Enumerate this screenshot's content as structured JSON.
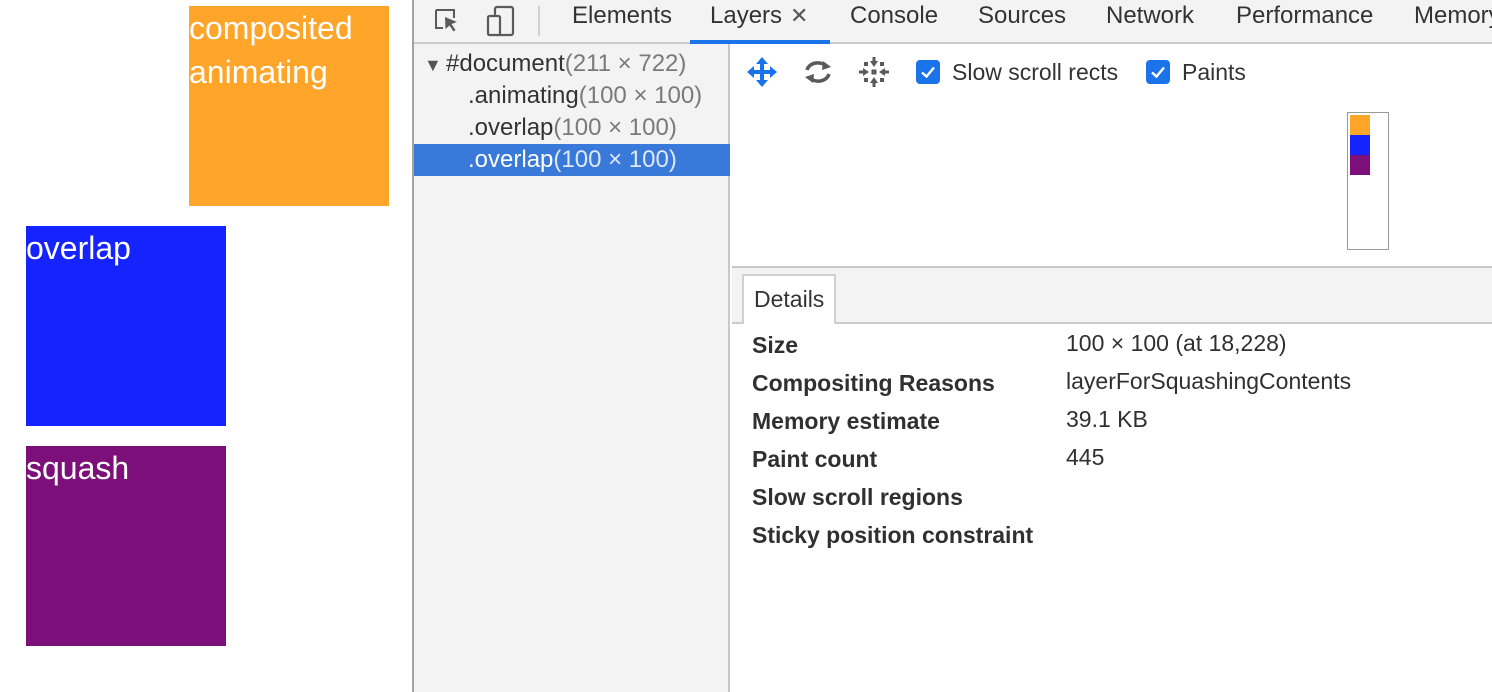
{
  "viewport": {
    "boxes": [
      {
        "id": "animating",
        "text_line1": "composited",
        "text_line2": "animating",
        "color": "#fea52a"
      },
      {
        "id": "overlap",
        "text_line1": "overlap",
        "color": "#1523ff"
      },
      {
        "id": "squash",
        "text_line1": "squash",
        "color": "#7c0f7a"
      }
    ]
  },
  "toolbar": {
    "icons": [
      "inspect-element-icon",
      "device-toolbar-icon"
    ],
    "tabs": [
      {
        "label": "Elements",
        "active": false
      },
      {
        "label": "Layers",
        "active": true,
        "closable": true,
        "close_glyph": "✕"
      },
      {
        "label": "Console",
        "active": false
      },
      {
        "label": "Sources",
        "active": false
      },
      {
        "label": "Network",
        "active": false
      },
      {
        "label": "Performance",
        "active": false
      },
      {
        "label": "Memory",
        "active": false
      }
    ],
    "accent": "#1a73e8"
  },
  "layer_tree": {
    "rows": [
      {
        "name": "#document",
        "size": "(211 × 722)",
        "expanded": true,
        "selected": false
      },
      {
        "name": ".animating",
        "size": "(100 × 100)",
        "selected": false
      },
      {
        "name": ".overlap",
        "size": "(100 × 100)",
        "selected": false
      },
      {
        "name": ".overlap",
        "size": "(100 × 100)",
        "selected": true
      }
    ],
    "selection_color": "#3879d9"
  },
  "view3d": {
    "tools": [
      "pan-mode-icon",
      "rotate-mode-icon",
      "reset-transform-icon"
    ],
    "checkboxes": [
      {
        "label": "Slow scroll rects",
        "checked": true
      },
      {
        "label": "Paints",
        "checked": true
      }
    ]
  },
  "details": {
    "tab_label": "Details",
    "properties": [
      {
        "key": "Size",
        "value": "100 × 100 (at 18,228)"
      },
      {
        "key": "Compositing Reasons",
        "value": "layerForSquashingContents"
      },
      {
        "key": "Memory estimate",
        "value": "39.1 KB"
      },
      {
        "key": "Paint count",
        "value": "445"
      },
      {
        "key": "Slow scroll regions",
        "value": ""
      },
      {
        "key": "Sticky position constraint",
        "value": ""
      }
    ]
  }
}
